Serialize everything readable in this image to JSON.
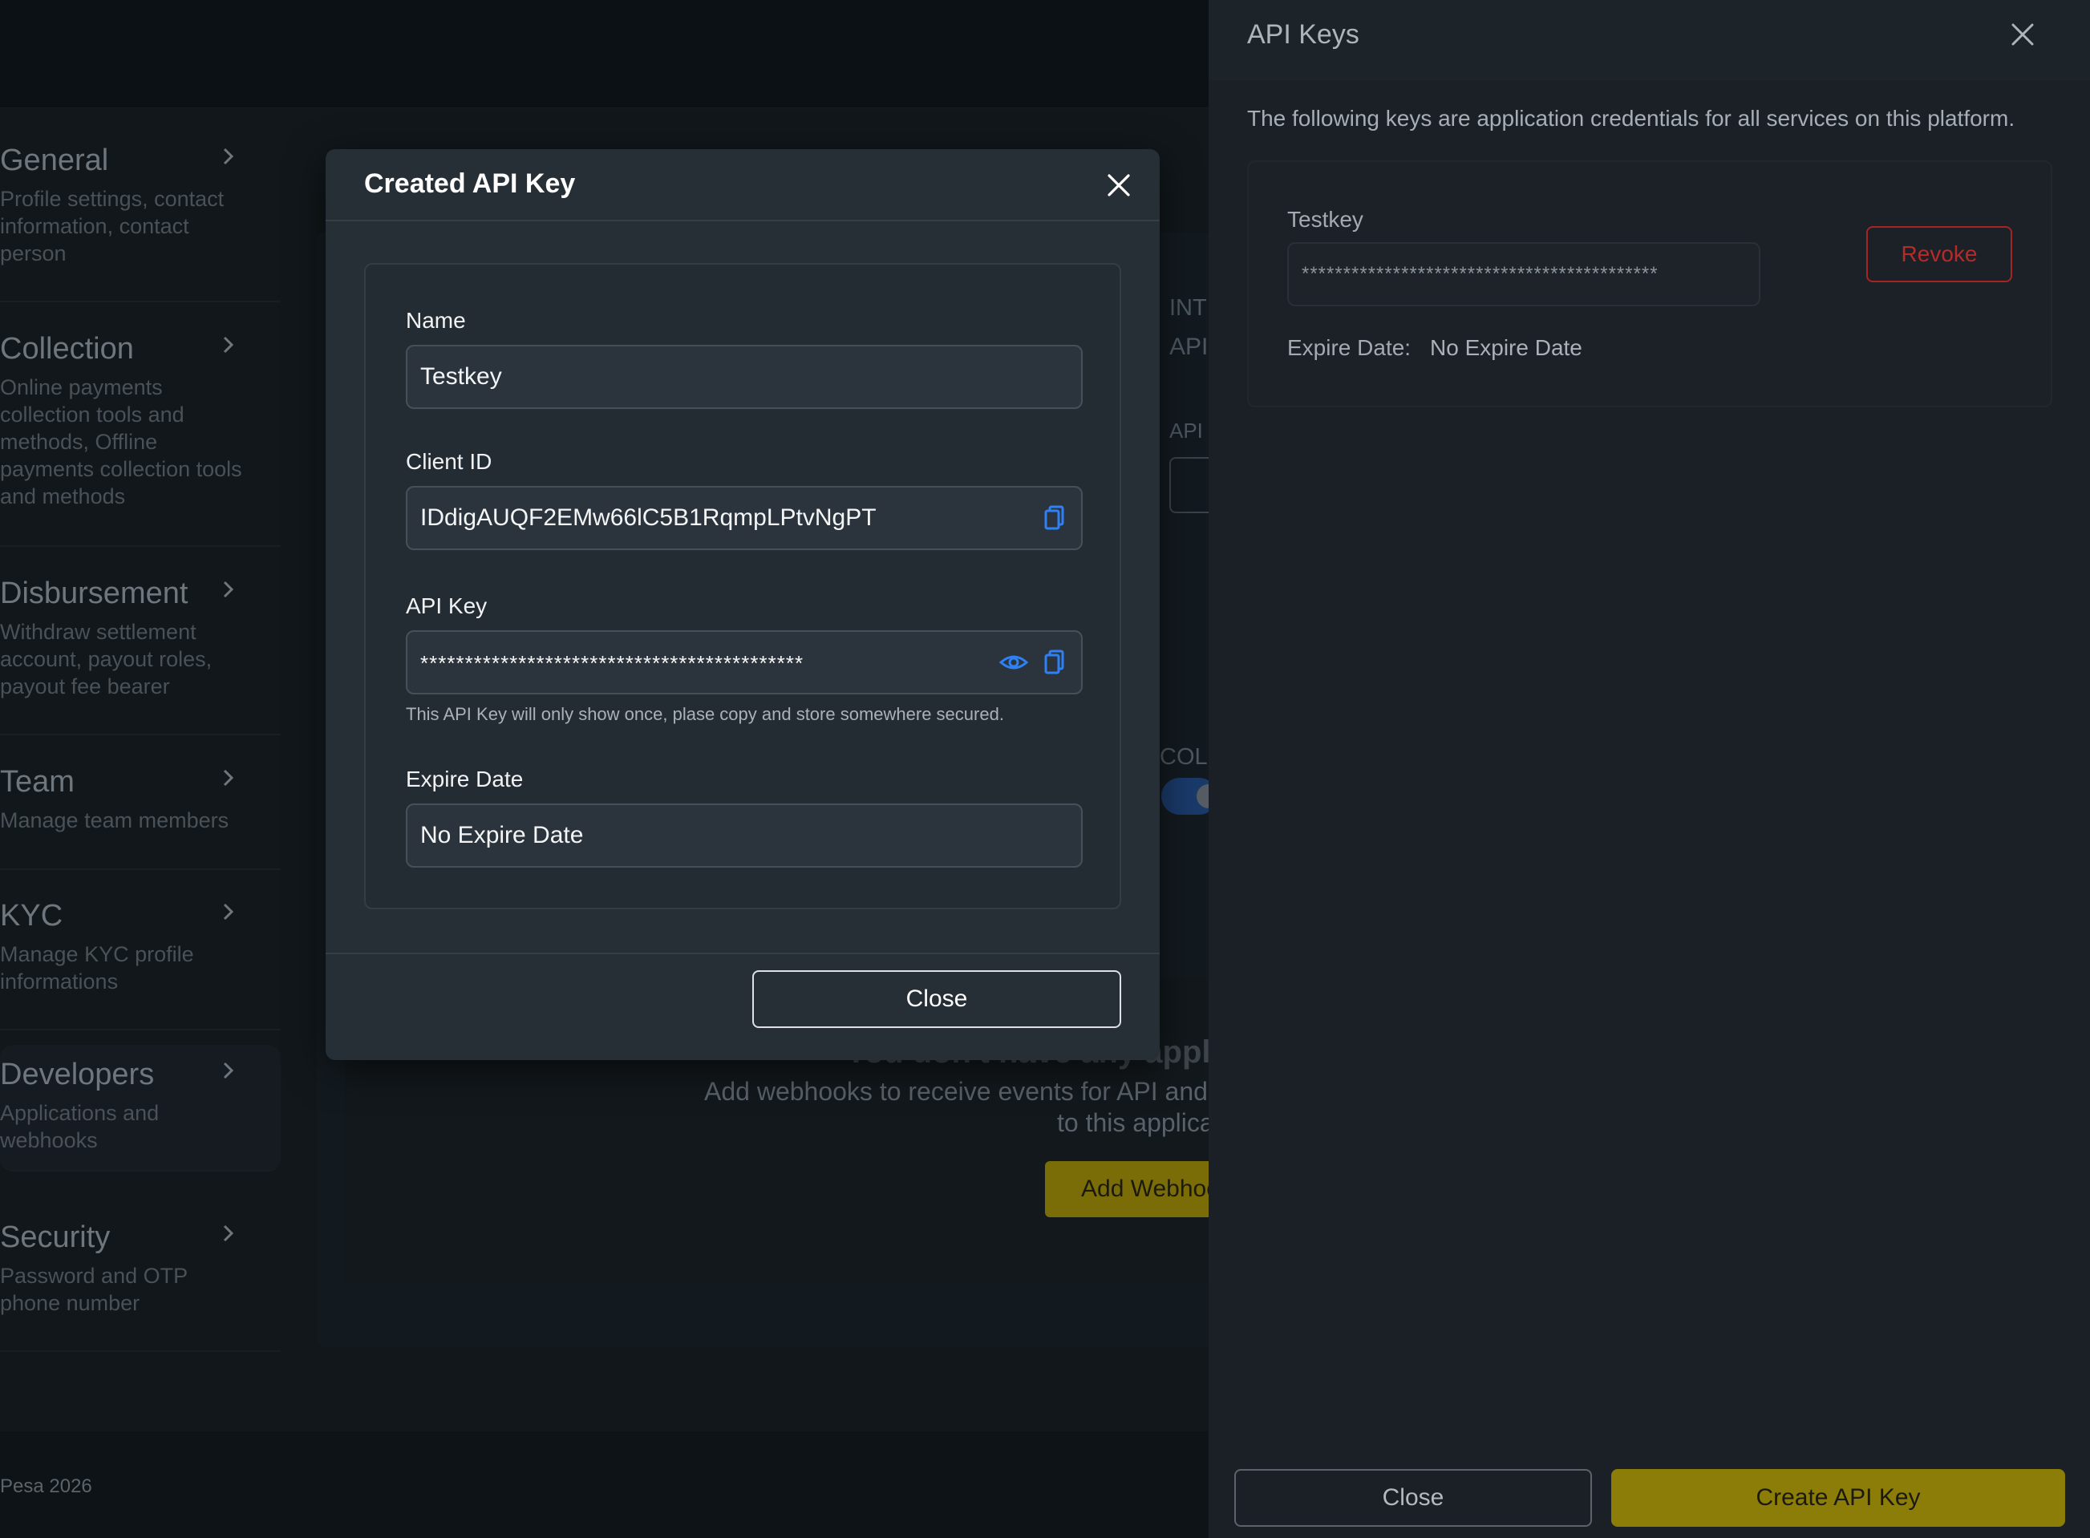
{
  "sidebar": {
    "items": [
      {
        "title": "General",
        "desc": "Profile settings, contact information, contact person"
      },
      {
        "title": "Collection",
        "desc": "Online payments collection tools and methods, Offline payments collection tools and methods"
      },
      {
        "title": "Disbursement",
        "desc": "Withdraw settlement account, payout roles, payout fee bearer"
      },
      {
        "title": "Team",
        "desc": "Manage team members"
      },
      {
        "title": "KYC",
        "desc": "Manage KYC profile informations"
      },
      {
        "title": "Developers",
        "desc": "Applications and webhooks"
      },
      {
        "title": "Security",
        "desc": "Password and OTP phone number"
      }
    ]
  },
  "footer": {
    "text": "Pesa 2026"
  },
  "background": {
    "frag_int": "INT",
    "frag_api1": "API",
    "frag_api2": "API",
    "frag_col": "COL",
    "empty_title": "You don't have any applica",
    "empty_desc_line1": "Add webhooks to receive events for API and",
    "empty_desc_line2": "to this applica",
    "add_webhook_label": "Add Webhoo"
  },
  "modal": {
    "title": "Created API Key",
    "name_label": "Name",
    "name_value": "Testkey",
    "client_id_label": "Client ID",
    "client_id_value": "IDdigAUQF2EMw66lC5B1RqmpLPtvNgPT",
    "api_key_label": "API Key",
    "api_key_value": "*******************************************",
    "api_key_helper": "This API Key will only show once, plase copy and store somewhere secured.",
    "expire_label": "Expire Date",
    "expire_value": "No Expire Date",
    "close_label": "Close"
  },
  "drawer": {
    "title": "API Keys",
    "description": "The following keys are application credentials for all services on this platform.",
    "key": {
      "name": "Testkey",
      "masked": "*******************************************",
      "revoke_label": "Revoke",
      "expire_label": "Expire Date:",
      "expire_value": "No Expire Date"
    },
    "close_label": "Close",
    "create_label": "Create API Key"
  },
  "colors": {
    "accent_blue": "#2f7ff5",
    "create_button": "#8b7d08",
    "revoke_red": "#b52a2a"
  }
}
